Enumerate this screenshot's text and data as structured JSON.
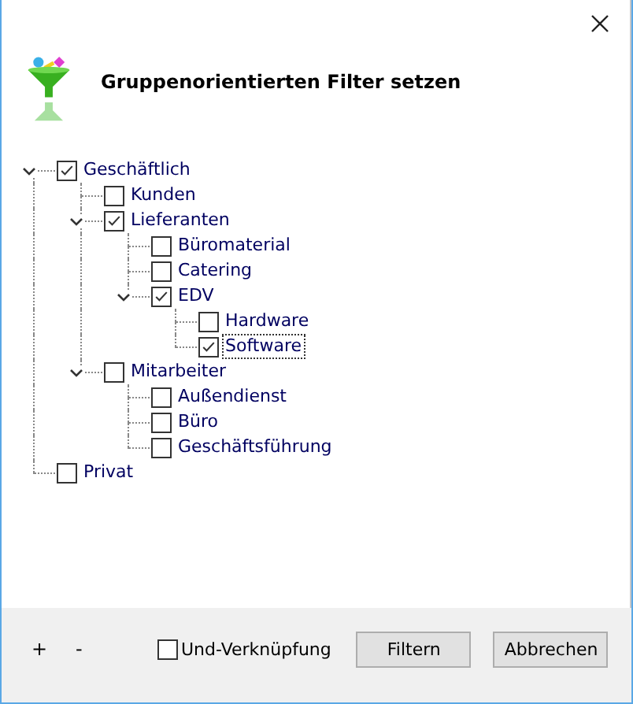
{
  "dialog": {
    "title": "Gruppenorientierten Filter setzen"
  },
  "tree": [
    {
      "label": "Geschäftlich",
      "checked": true,
      "selected": false,
      "expanded": true,
      "children": [
        {
          "label": "Kunden",
          "checked": false,
          "selected": false
        },
        {
          "label": "Lieferanten",
          "checked": true,
          "selected": false,
          "expanded": true,
          "children": [
            {
              "label": "Büromaterial",
              "checked": false,
              "selected": false
            },
            {
              "label": "Catering",
              "checked": false,
              "selected": false
            },
            {
              "label": "EDV",
              "checked": true,
              "selected": false,
              "expanded": true,
              "children": [
                {
                  "label": "Hardware",
                  "checked": false,
                  "selected": false
                },
                {
                  "label": "Software",
                  "checked": true,
                  "selected": true
                }
              ]
            }
          ]
        },
        {
          "label": "Mitarbeiter",
          "checked": false,
          "selected": false,
          "expanded": true,
          "children": [
            {
              "label": "Außendienst",
              "checked": false,
              "selected": false
            },
            {
              "label": "Büro",
              "checked": false,
              "selected": false
            },
            {
              "label": "Geschäftsführung",
              "checked": false,
              "selected": false
            }
          ]
        }
      ]
    },
    {
      "label": "Privat",
      "checked": false,
      "selected": false
    }
  ],
  "footer": {
    "add": "+",
    "remove": "-",
    "and_link": {
      "label": "Und-Verknüpfung",
      "checked": false
    },
    "buttons": [
      "Filtern",
      "Abbrechen"
    ]
  }
}
